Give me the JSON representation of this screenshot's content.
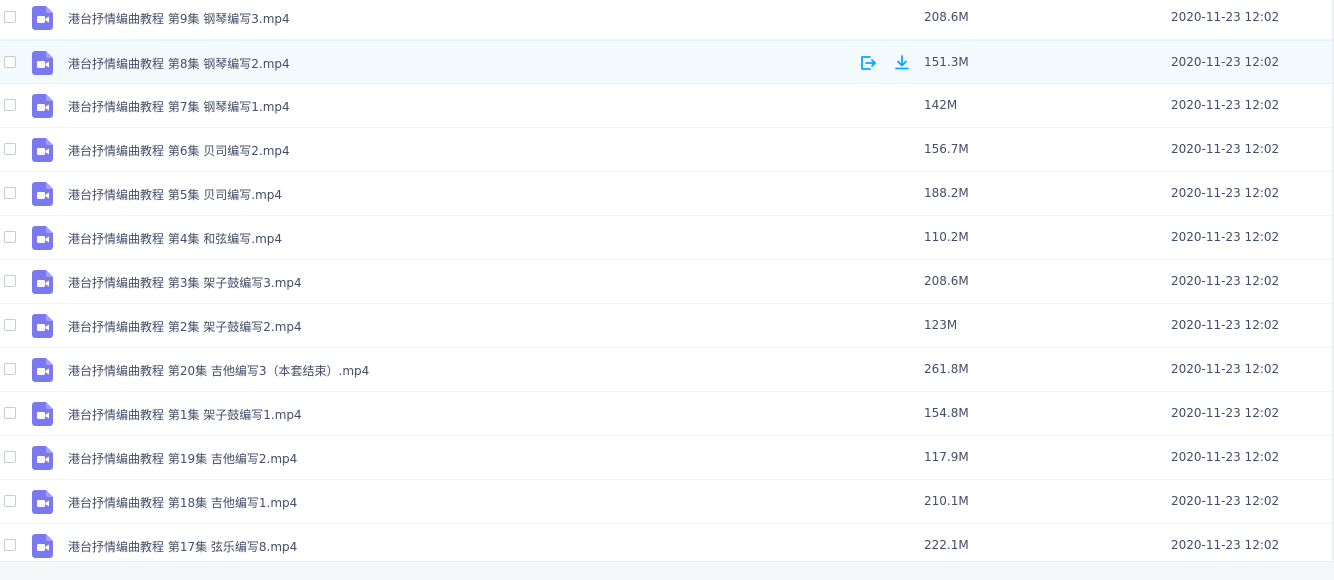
{
  "colors": {
    "accent": "#06a7ff",
    "video_icon": "#7b79ef",
    "text": "#424e67"
  },
  "icons": {
    "file": "video-file-icon",
    "share": "share-icon",
    "download": "download-icon"
  },
  "files": [
    {
      "name": "港台抒情编曲教程 第9集 钢琴编写3.mp4",
      "size": "208.6M",
      "date": "2020-11-23 12:02"
    },
    {
      "name": "港台抒情编曲教程 第8集 钢琴编写2.mp4",
      "size": "151.3M",
      "date": "2020-11-23 12:02",
      "hover": true
    },
    {
      "name": "港台抒情编曲教程 第7集 钢琴编写1.mp4",
      "size": "142M",
      "date": "2020-11-23 12:02"
    },
    {
      "name": "港台抒情编曲教程 第6集 贝司编写2.mp4",
      "size": "156.7M",
      "date": "2020-11-23 12:02"
    },
    {
      "name": "港台抒情编曲教程 第5集 贝司编写.mp4",
      "size": "188.2M",
      "date": "2020-11-23 12:02"
    },
    {
      "name": "港台抒情编曲教程 第4集 和弦编写.mp4",
      "size": "110.2M",
      "date": "2020-11-23 12:02"
    },
    {
      "name": "港台抒情编曲教程 第3集 架子鼓编写3.mp4",
      "size": "208.6M",
      "date": "2020-11-23 12:02"
    },
    {
      "name": "港台抒情编曲教程 第2集 架子鼓编写2.mp4",
      "size": "123M",
      "date": "2020-11-23 12:02"
    },
    {
      "name": "港台抒情编曲教程 第20集 吉他编写3（本套结束）.mp4",
      "size": "261.8M",
      "date": "2020-11-23 12:02"
    },
    {
      "name": "港台抒情编曲教程 第1集 架子鼓编写1.mp4",
      "size": "154.8M",
      "date": "2020-11-23 12:02"
    },
    {
      "name": "港台抒情编曲教程 第19集 吉他编写2.mp4",
      "size": "117.9M",
      "date": "2020-11-23 12:02"
    },
    {
      "name": "港台抒情编曲教程 第18集 吉他编写1.mp4",
      "size": "210.1M",
      "date": "2020-11-23 12:02"
    },
    {
      "name": "港台抒情编曲教程 第17集 弦乐编写8.mp4",
      "size": "222.1M",
      "date": "2020-11-23 12:02"
    }
  ]
}
